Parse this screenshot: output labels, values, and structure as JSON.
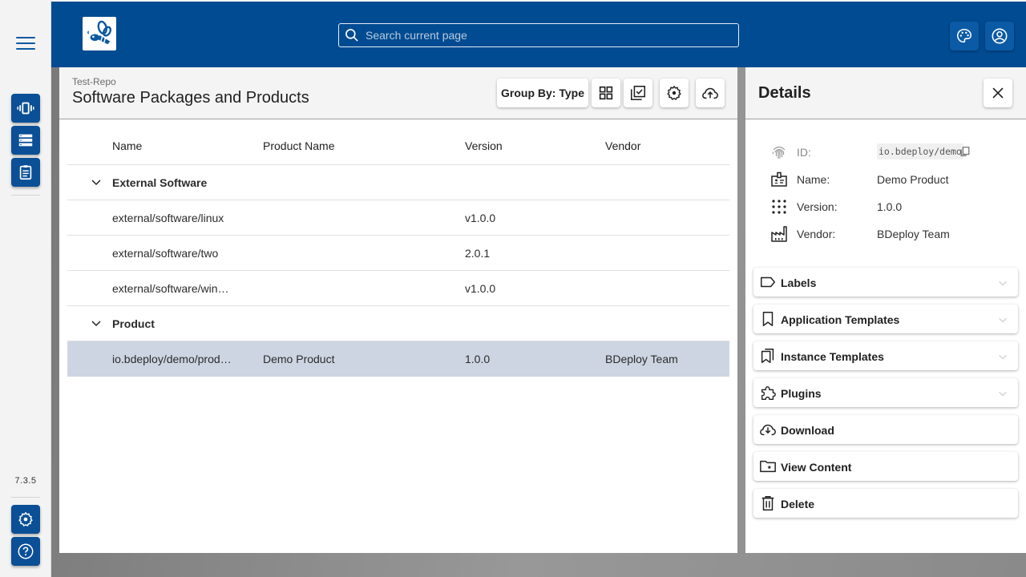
{
  "app": {
    "version": "7.3.5",
    "brand_color": "#004b91",
    "accent_color": "#0b4f96"
  },
  "rail": {
    "items": [
      {
        "name": "instances",
        "icon": "vibration-icon"
      },
      {
        "name": "repositories",
        "icon": "storage-icon"
      },
      {
        "name": "clipboard",
        "icon": "assignment-icon"
      }
    ],
    "bottom": [
      {
        "name": "settings",
        "icon": "gear-icon"
      },
      {
        "name": "help",
        "icon": "help-icon"
      }
    ]
  },
  "header": {
    "search_placeholder": "Search current page",
    "theme_icon": "palette-icon",
    "user_icon": "account-icon"
  },
  "main": {
    "breadcrumb": "Test-Repo",
    "title": "Software Packages and Products",
    "toolbar": {
      "group_by_label": "Group By: Type"
    },
    "columns": [
      "Name",
      "Product Name",
      "Version",
      "Vendor"
    ],
    "groups": [
      {
        "label": "External Software",
        "rows": [
          {
            "name": "external/software/linux",
            "product_name": "",
            "version": "v1.0.0",
            "vendor": ""
          },
          {
            "name": "external/software/two",
            "product_name": "",
            "version": "2.0.1",
            "vendor": ""
          },
          {
            "name": "external/software/win…",
            "product_name": "",
            "version": "v1.0.0",
            "vendor": ""
          }
        ]
      },
      {
        "label": "Product",
        "rows": [
          {
            "name": "io.bdeploy/demo/prod…",
            "product_name": "Demo Product",
            "version": "1.0.0",
            "vendor": "BDeploy Team",
            "selected": true
          }
        ]
      }
    ]
  },
  "details": {
    "title": "Details",
    "props": [
      {
        "label": "ID:",
        "value": "io.bdeploy/demo"
      },
      {
        "label": "Name:",
        "value": "Demo Product"
      },
      {
        "label": "Version:",
        "value": "1.0.0"
      },
      {
        "label": "Vendor:",
        "value": "BDeploy Team"
      }
    ],
    "panels": [
      {
        "label": "Labels"
      },
      {
        "label": "Application Templates"
      },
      {
        "label": "Instance Templates"
      },
      {
        "label": "Plugins"
      }
    ],
    "actions": [
      {
        "label": "Download"
      },
      {
        "label": "View Content"
      },
      {
        "label": "Delete"
      }
    ]
  }
}
